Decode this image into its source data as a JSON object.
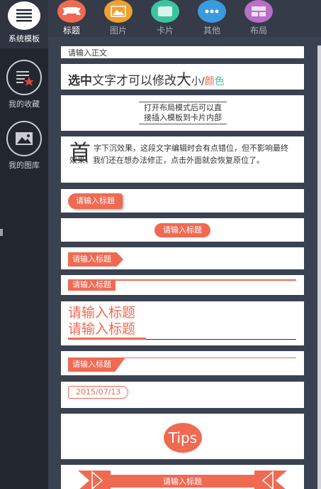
{
  "colors": {
    "accent": "#f06a52",
    "sidebar_bg": "#22262f",
    "content_bg": "#3a4150"
  },
  "sidebar": {
    "items": [
      {
        "label": "系统模板",
        "icon": "template-list-icon",
        "active": true
      },
      {
        "label": "我的收藏",
        "icon": "favorites-icon",
        "active": false
      },
      {
        "label": "我的图库",
        "icon": "gallery-icon",
        "active": false
      }
    ]
  },
  "tabs": [
    {
      "label": "标题",
      "icon": "title-ribbon-icon",
      "color": "#f06a52",
      "active": true
    },
    {
      "label": "图片",
      "icon": "image-icon",
      "color": "#f0a030",
      "active": false
    },
    {
      "label": "卡片",
      "icon": "card-icon",
      "color": "#3cc4a0",
      "active": false
    },
    {
      "label": "其他",
      "icon": "more-dots-icon",
      "color": "#3a9ae0",
      "active": false
    },
    {
      "label": "布局",
      "icon": "layout-icon",
      "color": "#b86fc8",
      "active": false
    }
  ],
  "cards": {
    "body_text": "请输入正文",
    "sel_1": "选中",
    "sel_2": "文字才可以修改",
    "sel_3": "大",
    "sel_4": "小/",
    "sel_5": "颜",
    "sel_6": "色",
    "layout_hint_1": "打开布局模式后可以直",
    "layout_hint_2": "接插入模板到卡片内部",
    "dropcap_char": "首",
    "dropcap_text": "字下沉效果，这段文字编辑时会有点错位，但不影响最终效果，我们还在想办法修正，点击外面就会恢复原位了。",
    "title_placeholder": "请输入标题",
    "title_two_lines_1": "请输入标题",
    "title_two_lines_2": "请输入标题",
    "date": "2015/07/13",
    "tips": "Tips"
  }
}
